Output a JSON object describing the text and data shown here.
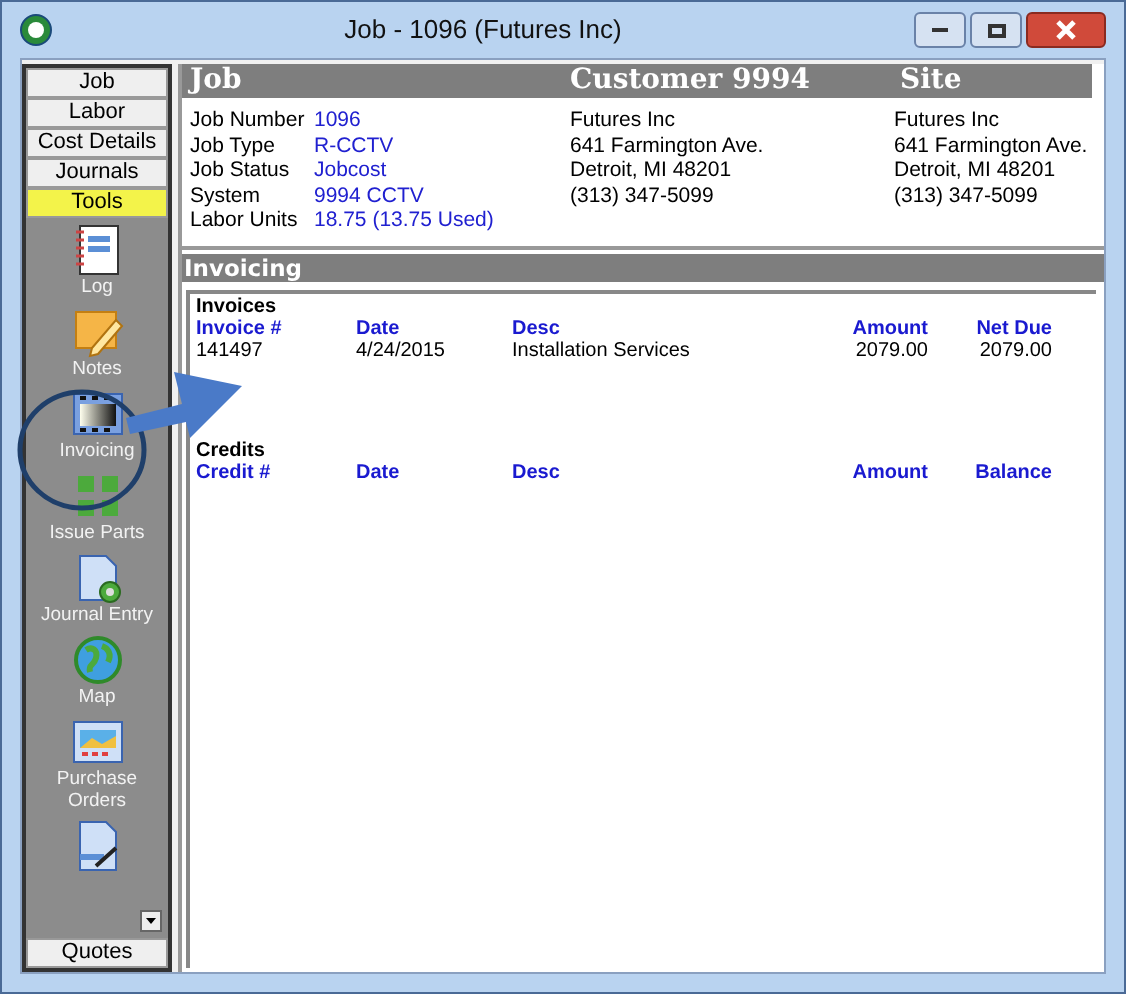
{
  "window": {
    "title": "Job - 1096 (Futures  Inc)"
  },
  "sidebar": {
    "tabs": [
      {
        "label": "Job",
        "selected": false
      },
      {
        "label": "Labor",
        "selected": false
      },
      {
        "label": "Cost Details",
        "selected": false
      },
      {
        "label": "Journals",
        "selected": false
      },
      {
        "label": "Tools",
        "selected": true
      }
    ],
    "tools": [
      {
        "kind": "log",
        "label": "Log"
      },
      {
        "kind": "notes",
        "label": "Notes"
      },
      {
        "kind": "invoicing",
        "label": "Invoicing"
      },
      {
        "kind": "parts",
        "label": "Issue Parts"
      },
      {
        "kind": "journal",
        "label": "Journal Entry"
      },
      {
        "kind": "map",
        "label": "Map"
      },
      {
        "kind": "orders",
        "label": "Purchase Orders"
      },
      {
        "kind": "quotes"
      }
    ],
    "bottom_tabs": [
      {
        "label": "Quotes",
        "selected": false
      }
    ]
  },
  "header": {
    "job_title": "Job",
    "customer_title": "Customer 9994",
    "site_title": "Site"
  },
  "job_fields": [
    {
      "label": "Job Number",
      "value": "1096"
    },
    {
      "label": "Job Type",
      "value": "R-CCTV"
    },
    {
      "label": "Job Status",
      "value": "Jobcost"
    },
    {
      "label": "System",
      "value": "9994 CCTV"
    },
    {
      "label": "Labor Units",
      "value": "18.75 (13.75 Used)"
    }
  ],
  "customer": [
    "Futures  Inc",
    "641 Farmington Ave.",
    "Detroit, MI  48201",
    "(313) 347-5099"
  ],
  "site": [
    "Futures  Inc",
    "641 Farmington Ave.",
    "Detroit, MI  48201",
    "(313) 347-5099"
  ],
  "section_title": "Invoicing",
  "invoices": {
    "title": "Invoices",
    "columns": [
      "Invoice #",
      "Date",
      "Desc",
      "Amount",
      "Net Due"
    ],
    "rows": [
      [
        "141497",
        "4/24/2015",
        "Installation Services",
        "2079.00",
        "2079.00"
      ]
    ]
  },
  "credits": {
    "title": "Credits",
    "columns": [
      "Credit #",
      "Date",
      "Desc",
      "Amount",
      "Balance"
    ]
  }
}
